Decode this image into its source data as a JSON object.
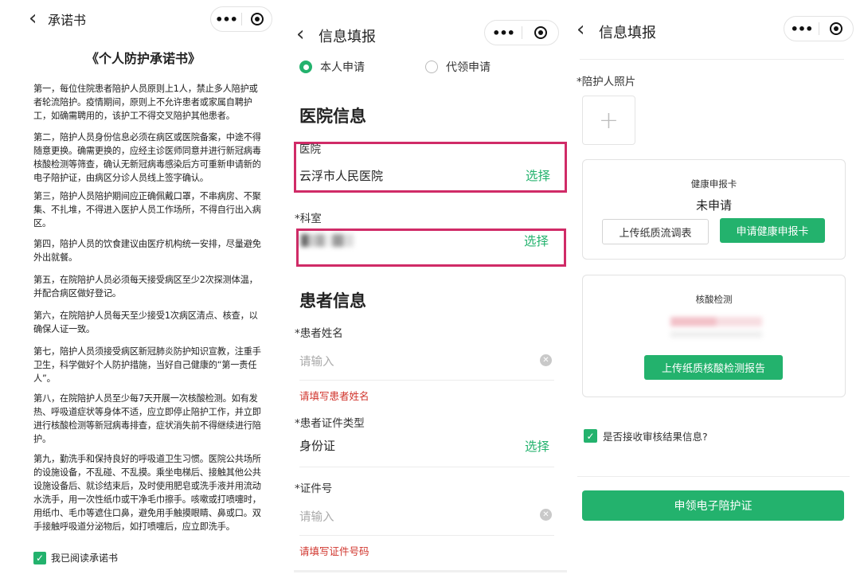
{
  "panel1": {
    "nav": {
      "back": "‹",
      "title": "承诺书"
    },
    "doc_title": "《个人防护承诺书》",
    "paragraphs": [
      "第一，每位住院患者陪护人员原则上1人，禁止多人陪护或者轮流陪护。疫情期间，原则上不允许患者或家属自聘护工，如确需聘用的，该护工不得交叉陪护其他患者。",
      "第二，陪护人员身份信息必须在病区或医院备案，中途不得随意更换。确需更换的，应经主诊医师同意并进行新冠病毒核酸检测等筛查，确认无新冠病毒感染后方可重新申请新的电子陪护证，由病区分诊人员线上签字确认。",
      "第三，陪护人员陪护期间应正确佩戴口罩，不串病房、不聚集、不扎堆，不得进入医护人员工作场所，不得自行出入病区。",
      "第四，陪护人员的饮食建议由医疗机构统一安排，尽量避免外出就餐。",
      "第五，在院陪护人员必须每天接受病区至少2次探测体温，并配合病区做好登记。",
      "第六，在院陪护人员每天至少接受1次病区清点、核查，以确保人证一致。",
      "第七，陪护人员须接受病区新冠肺炎防护知识宣教，注重手卫生，科学做好个人防护措施，当好自己健康的“第一责任人”。",
      "第八，在院陪护人员至少每7天开展一次核酸检测。如有发热、呼吸道症状等身体不适，应立即停止陪护工作，并立即进行核酸检测等新冠病毒排查，症状消失前不得继续进行陪护。",
      "第九，勤洗手和保持良好的呼吸道卫生习惯。医院公共场所的设施设备，不乱碰、不乱摸。乘坐电梯后、接触其他公共设施设备后、就诊结束后，及时使用肥皂或洗手液并用流动水洗手，用一次性纸巾或干净毛巾擦手。咳嗽或打喷嚏时，用纸巾、毛巾等遮住口鼻，避免用手触摸眼睛、鼻或口。双手接触呼吸道分泌物后，如打喷嚏后，应立即洗手。"
    ],
    "agree_label": "我已阅读承诺书"
  },
  "panel2": {
    "nav": {
      "back": "‹",
      "title": "信息填报"
    },
    "radio_self": "本人申请",
    "radio_proxy": "代领申请",
    "section_hospital": "医院信息",
    "hospital_label": "医院",
    "hospital_value": "云浮市人民医院",
    "dept_label": "*科室",
    "select_label": "选择",
    "section_patient": "患者信息",
    "patient_name_label": "*患者姓名",
    "input_placeholder": "请输入",
    "patient_name_error": "请填写患者姓名",
    "id_type_label": "*患者证件类型",
    "id_type_value": "身份证",
    "id_no_label": "*证件号",
    "id_no_error": "请填写证件号码"
  },
  "panel3": {
    "nav": {
      "back": "‹",
      "title": "信息填报"
    },
    "photo_label": "*陪护人照片",
    "photo_add": "+",
    "health_card_title": "健康申报卡",
    "health_card_status": "未申请",
    "upload_paper_survey": "上传纸质流调表",
    "apply_health_card": "申请健康申报卡",
    "nucleic_title": "核酸检测",
    "upload_nucleic_report": "上传纸质核酸检测报告",
    "receive_result_label": "是否接收审核结果信息?",
    "submit_button": "申领电子陪护证"
  },
  "colors": {
    "accent": "#23b26d",
    "highlight": "#d02b67",
    "error": "#d0342c"
  }
}
